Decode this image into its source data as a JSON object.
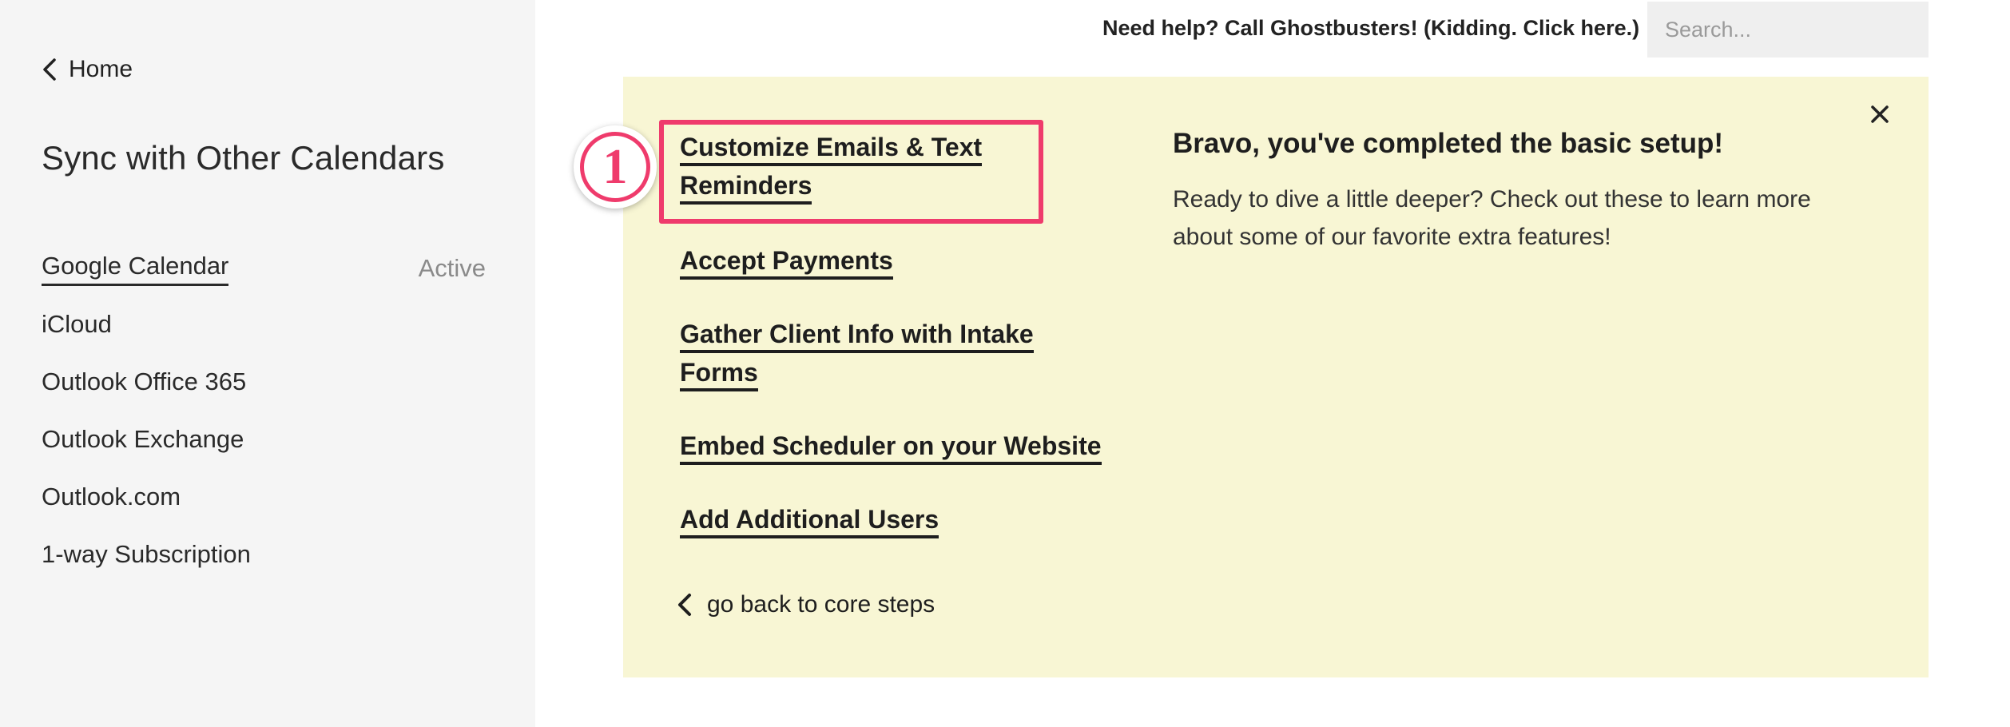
{
  "sidebar": {
    "back_label": "Home",
    "title": "Sync with Other Calendars",
    "items": [
      {
        "label": "Google Calendar",
        "status": "Active"
      },
      {
        "label": "iCloud",
        "status": ""
      },
      {
        "label": "Outlook Office 365",
        "status": ""
      },
      {
        "label": "Outlook Exchange",
        "status": ""
      },
      {
        "label": "Outlook.com",
        "status": ""
      },
      {
        "label": "1-way Subscription",
        "status": ""
      }
    ]
  },
  "header": {
    "help_text": "Need help? Call Ghostbusters! (Kidding. Click here.)",
    "search_placeholder": "Search..."
  },
  "panel": {
    "badge_number": "1",
    "steps": [
      {
        "line1": "Customize Emails & Text",
        "line2": "Reminders"
      },
      {
        "line1": "Accept Payments",
        "line2": ""
      },
      {
        "line1": "Gather Client Info with Intake",
        "line2": "Forms"
      },
      {
        "line1": "Embed Scheduler on your Website",
        "line2": ""
      },
      {
        "line1": "Add Additional Users",
        "line2": ""
      }
    ],
    "go_back_label": "go back to core steps",
    "bravo_title": "Bravo, you've completed the basic setup!",
    "bravo_text": "Ready to dive a little deeper? Check out these to learn more about some of our favorite extra features!"
  },
  "colors": {
    "sidebar_bg": "#f5f5f5",
    "panel_bg": "#f8f6d4",
    "highlight": "#ef3b6c",
    "search_bg": "#efefef"
  }
}
